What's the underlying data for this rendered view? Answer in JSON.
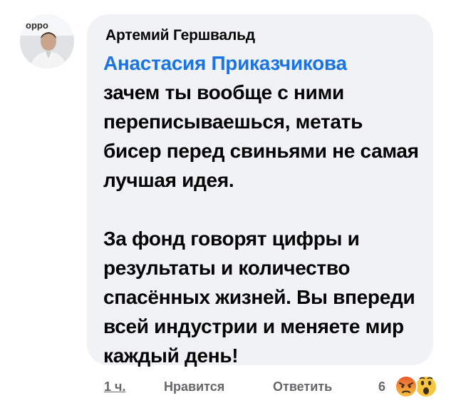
{
  "comment": {
    "author": "Артемий Гершвальд",
    "mention": "Анастасия Приказчикова",
    "paragraph1": "зачем ты вообще с ними переписываешься, метать бисер перед свиньями не самая лучшая идея.",
    "paragraph2": "За фонд говорят цифры и результаты и количество спасённых жизней. Вы впереди всей индустрии и меняете мир каждый день!"
  },
  "avatar": {
    "logo_text": "oppo",
    "icon": "profile-photo-icon"
  },
  "footer": {
    "time": "1 ч.",
    "like_label": "Нравится",
    "reply_label": "Ответить",
    "reaction_count": "6",
    "reactions": [
      "angry-reaction-icon",
      "wow-reaction-icon"
    ]
  },
  "colors": {
    "bubble": "#f0f2f5",
    "mention": "#1b74e4",
    "secondary_text": "#65676b"
  }
}
